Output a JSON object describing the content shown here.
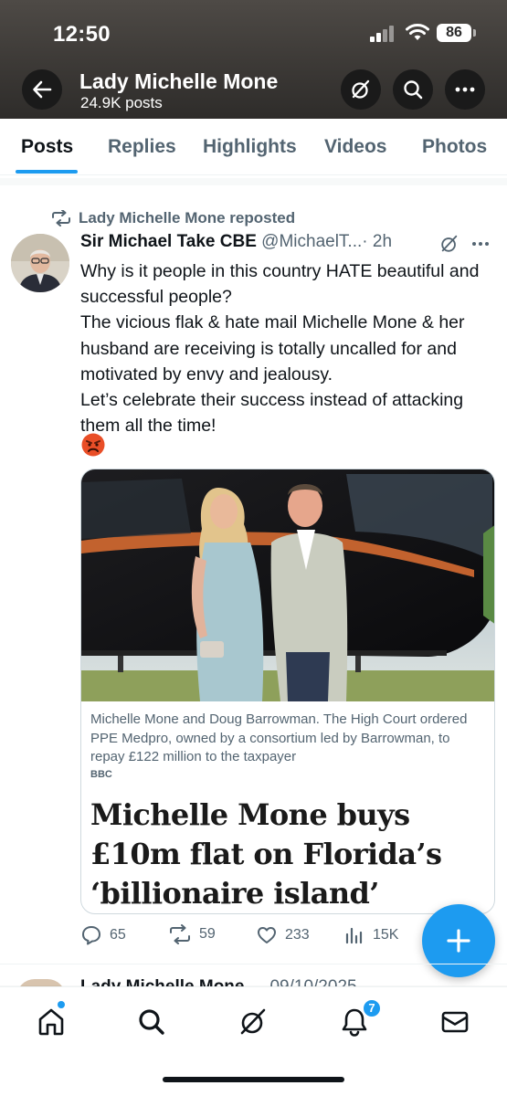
{
  "status_bar": {
    "time": "12:50",
    "battery": "86"
  },
  "header": {
    "title": "Lady Michelle Mone",
    "post_count": "24.9K posts",
    "icons": [
      "back-arrow-icon",
      "grok-icon",
      "search-icon",
      "more-icon"
    ]
  },
  "tabs": [
    {
      "label": "Posts",
      "active": true
    },
    {
      "label": "Replies",
      "active": false
    },
    {
      "label": "Highlights",
      "active": false
    },
    {
      "label": "Videos",
      "active": false
    },
    {
      "label": "Photos",
      "active": false
    }
  ],
  "post": {
    "repost_label": "Lady Michelle Mone reposted",
    "author_name": "Sir Michael Take CBE",
    "author_handle": "@MichaelT...",
    "time": "· 2h",
    "text_lines": [
      "Why is it people in this country HATE beautiful and successful people?",
      "The vicious flak & hate mail Michelle Mone & her husband are receiving is totally uncalled for and motivated by envy and jealousy.",
      "Let’s celebrate their success instead of attacking them all the time!"
    ],
    "emoji": "angry-face-icon",
    "card": {
      "caption": "Michelle Mone and Doug Barrowman. The High Court ordered PPE Medpro, owned by a consortium led by Barrowman, to repay £122 million to the taxpayer",
      "source": "BBC",
      "headline": "Michelle Mone buys £10m flat on Florida’s ‘billionaire island’"
    },
    "stats": {
      "replies": "65",
      "reposts": "59",
      "likes": "233",
      "views": "15K"
    }
  },
  "next_post": {
    "author_name": "Lady Michelle Mone",
    "date": "09/10/2025"
  },
  "bottom_nav": {
    "items": [
      "home-icon",
      "search-icon",
      "grok-icon",
      "notifications-icon",
      "messages-icon"
    ],
    "notification_count": "7"
  },
  "colors": {
    "accent": "#1d9bf0",
    "text": "#0f1419",
    "secondary": "#536471"
  }
}
